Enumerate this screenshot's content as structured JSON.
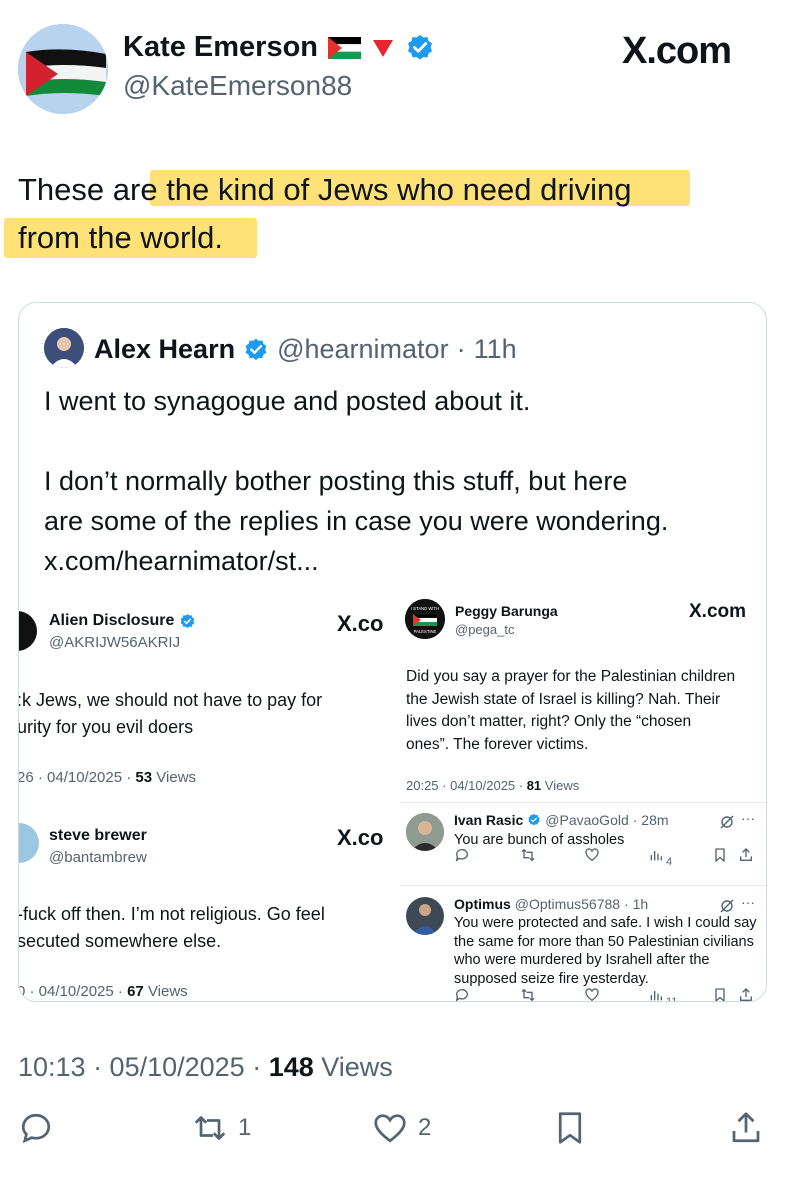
{
  "author": {
    "display_name": "Kate Emerson",
    "handle": "@KateEmerson88",
    "icons": [
      "palestine-flag-icon",
      "red-down-triangle-icon",
      "verified-badge-icon"
    ]
  },
  "brand": "X.com",
  "tweet": {
    "line1": "These are the kind of Jews who need driving",
    "line2": "from the world.",
    "highlight_color": "#ffd84a"
  },
  "quote": {
    "name": "Alex Hearn",
    "handle": "@hearnimator",
    "separator": "·",
    "age": "11h",
    "p1": "I went to synagogue and posted about it.",
    "p2a": "I don’t normally bother posting this stuff, but here",
    "p2b": "are some of the replies in case you were wondering.",
    "link": "x.com/hearnimator/st..."
  },
  "shot_left_1": {
    "name": "Alien Disclosure",
    "handle": "@AKRIJW56AKRIJ",
    "brand": "X.co",
    "line1": ":k Jews, we should not have to pay for",
    "line2": "urity for you evil doers",
    "time": "26 · 04/10/2025 · ",
    "views": "53",
    "views_label": "Views"
  },
  "shot_left_2": {
    "name": "steve brewer",
    "handle": "@bantambrew",
    "brand": "X.co",
    "line1": "-fuck off then. I’m not religious. Go feel",
    "line2": "secuted somewhere else.",
    "time": "0 · 04/10/2025 · ",
    "views": "67",
    "views_label": "Views"
  },
  "shot_right_1": {
    "name": "Peggy Barunga",
    "handle": "@pega_tc",
    "brand": "X.com",
    "avatar_text_top": "I STAND WITH",
    "avatar_text_bottom": "PALESTINE",
    "line1": "Did you say a prayer for the Palestinian children",
    "line2": "the Jewish state of Israel is killing? Nah. Their",
    "line3": "lives don’t matter, right? Only the “chosen",
    "line4": "ones”. The forever victims.",
    "time": "20:25 · 04/10/2025 · ",
    "views": "81",
    "views_label": "Views"
  },
  "reply_1": {
    "name": "Ivan Rasic",
    "handle": "@PavaoGold",
    "age": "· 28m",
    "text": "You are bunch of assholes",
    "view_count": "4"
  },
  "reply_2": {
    "name": "Optimus",
    "handle": "@Optimus56788",
    "age": "· 1h",
    "line1": "You were protected and safe. I wish I could say",
    "line2": "the same for more than 50 Palestinian civilians",
    "line3": "who were murdered by Israhell after the",
    "line4": "supposed seize fire yesterday.",
    "view_count": "11"
  },
  "footer": {
    "time": "10:13 · 05/10/2025 · ",
    "views": "148",
    "views_label": "Views"
  },
  "actions": {
    "reply_count": "",
    "repost_count": "1",
    "like_count": "2"
  }
}
